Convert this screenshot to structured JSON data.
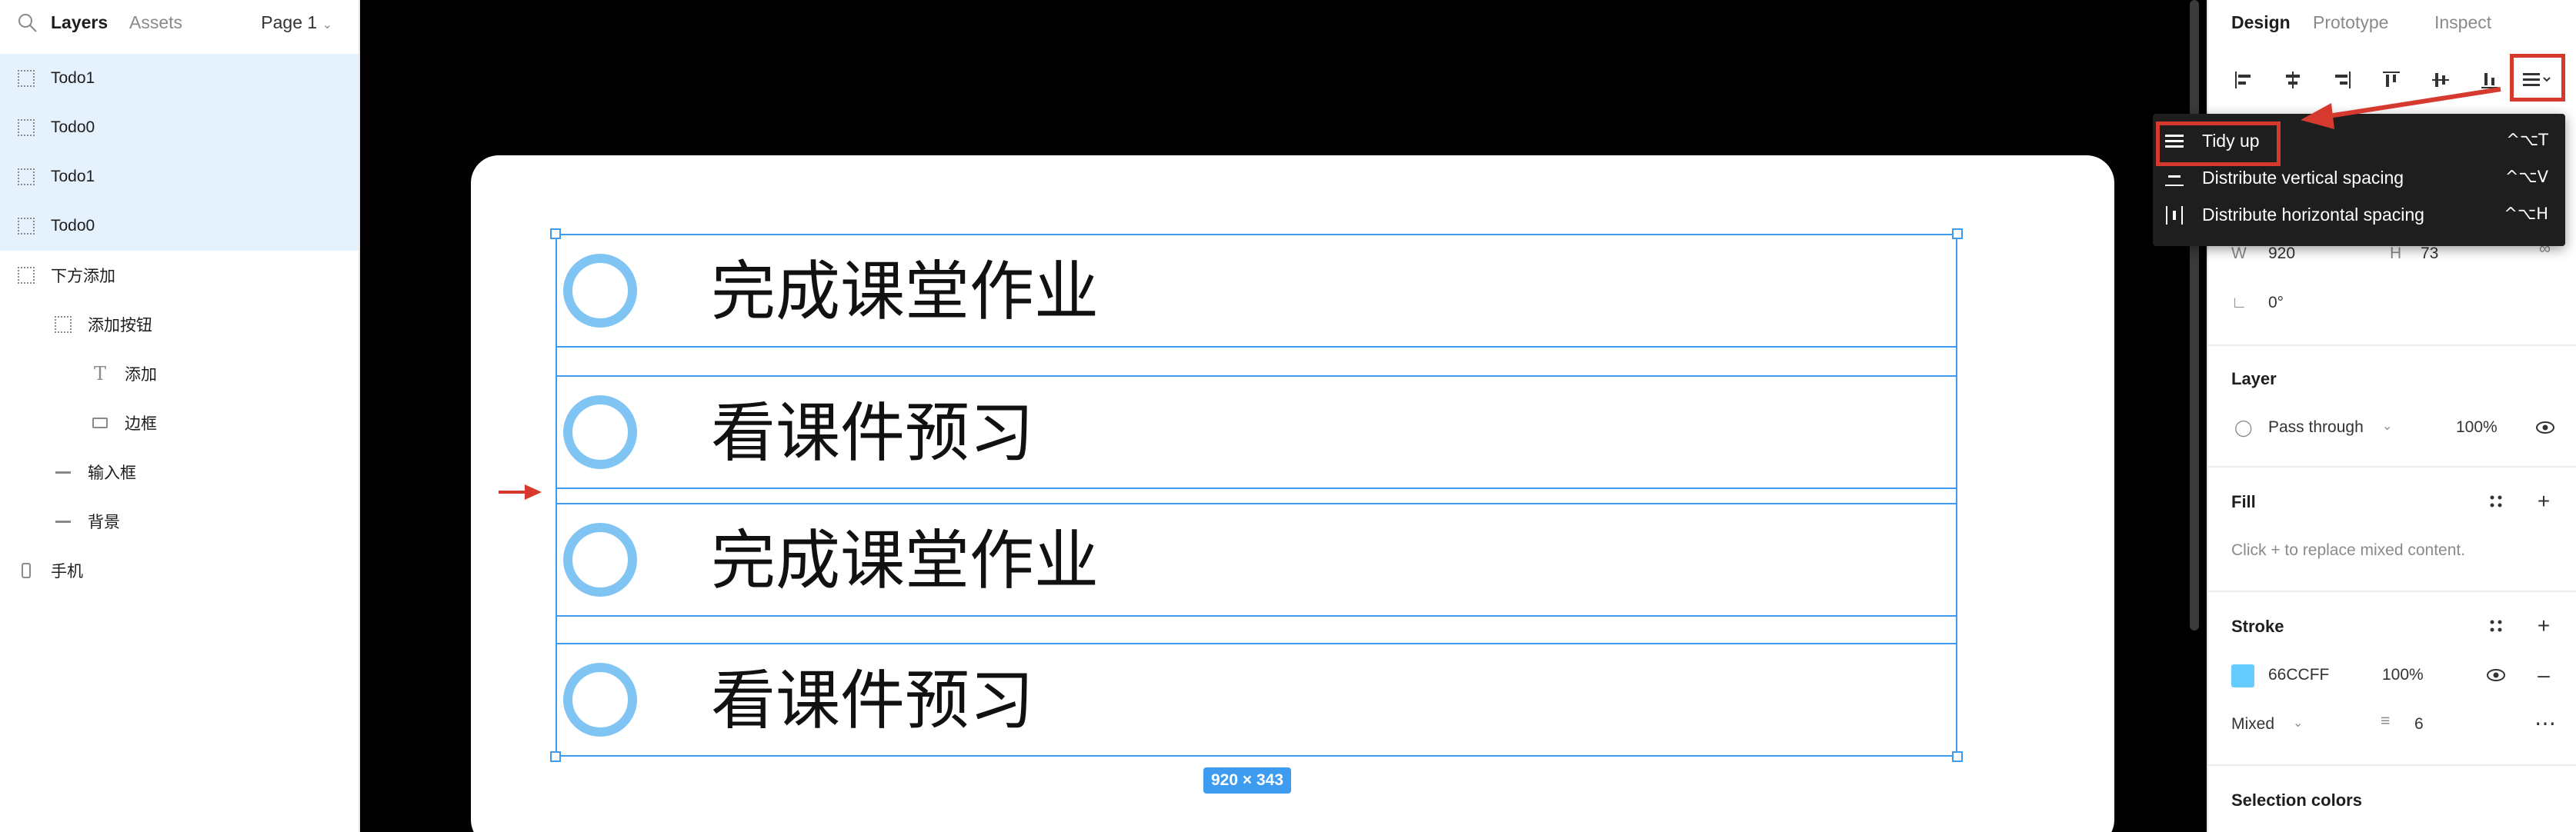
{
  "left_panel": {
    "tabs": [
      {
        "label": "Layers",
        "active": true
      },
      {
        "label": "Assets",
        "active": false
      }
    ],
    "page_selector": "Page 1",
    "layers": [
      {
        "label": "Todo1",
        "icon": "frame-icon",
        "selected": true
      },
      {
        "label": "Todo0",
        "icon": "frame-icon",
        "selected": true
      },
      {
        "label": "Todo1",
        "icon": "frame-icon",
        "selected": true
      },
      {
        "label": "Todo0",
        "icon": "frame-icon",
        "selected": true
      },
      {
        "label": "下方添加",
        "icon": "frame-icon",
        "selected": false
      },
      {
        "label": "添加按钮",
        "icon": "frame-icon",
        "selected": false
      },
      {
        "label": "添加",
        "icon": "text-icon",
        "selected": false
      },
      {
        "label": "边框",
        "icon": "rectangle-icon",
        "selected": false
      },
      {
        "label": "输入框",
        "icon": "line-icon",
        "selected": false
      },
      {
        "label": "背景",
        "icon": "line-icon",
        "selected": false
      },
      {
        "label": "手机",
        "icon": "phone-icon",
        "selected": false
      }
    ]
  },
  "canvas": {
    "todos": [
      {
        "text": "完成课堂作业"
      },
      {
        "text": "看课件预习"
      },
      {
        "text": "完成课堂作业"
      },
      {
        "text": "看课件预习"
      }
    ],
    "selection_size": "920 × 343",
    "accent": "#3d9cf0",
    "circle_color": "#7fc4f3"
  },
  "right_panel": {
    "tabs": [
      {
        "label": "Design",
        "active": true
      },
      {
        "label": "Prototype",
        "active": false
      },
      {
        "label": "Inspect",
        "active": false
      }
    ],
    "dimensions": {
      "w_label": "W",
      "w_value": "920",
      "h_label": "H",
      "h_value": "73",
      "rotation": "0°"
    },
    "layer": {
      "title": "Layer",
      "blend": "Pass through",
      "opacity": "100%"
    },
    "fill": {
      "title": "Fill",
      "hint": "Click + to replace mixed content."
    },
    "stroke": {
      "title": "Stroke",
      "color_hex": "66CCFF",
      "opacity": "100%",
      "style": "Mixed",
      "weight": "6",
      "swatch": "#66ccff"
    },
    "selection_colors": {
      "title": "Selection colors"
    }
  },
  "menu": {
    "items": [
      {
        "label": "Tidy up",
        "shortcut": "^⌥T",
        "icon": "tidy-up-icon"
      },
      {
        "label": "Distribute vertical spacing",
        "shortcut": "^⌥V",
        "icon": "distribute-vertical-icon"
      },
      {
        "label": "Distribute horizontal spacing",
        "shortcut": "^⌥H",
        "icon": "distribute-horizontal-icon"
      }
    ]
  },
  "annotation_color": "#d63a2f"
}
